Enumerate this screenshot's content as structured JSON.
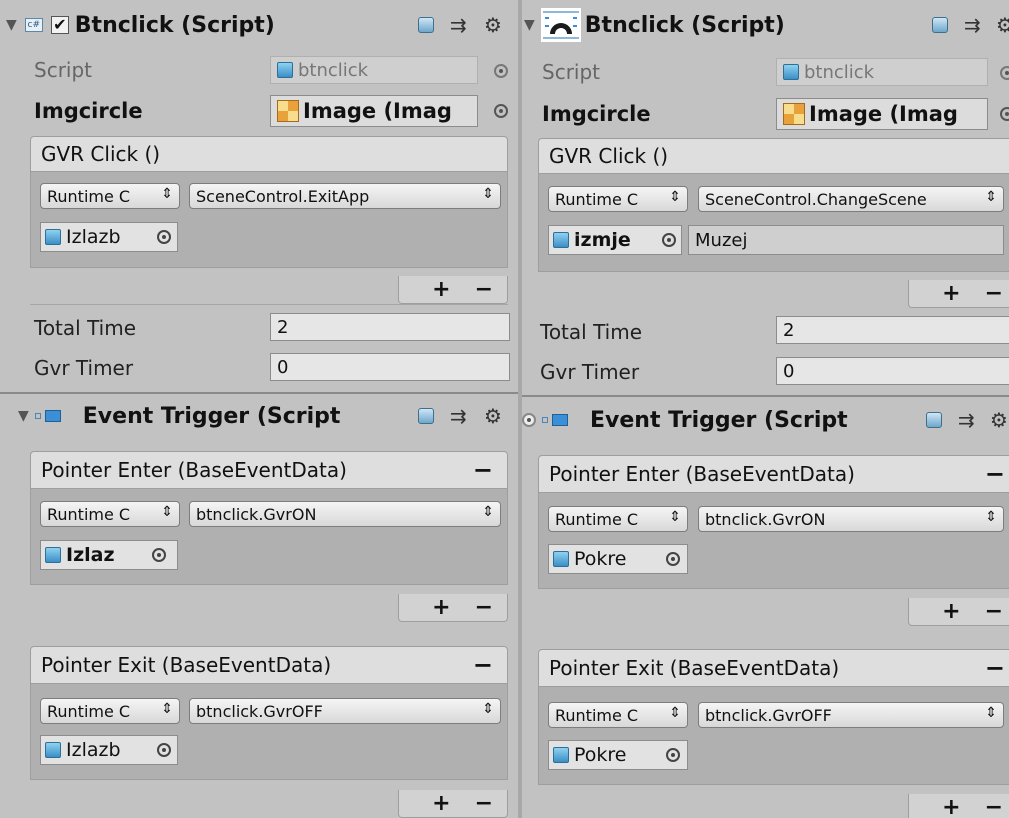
{
  "left": {
    "component_title": "Btnclick (Script)",
    "script_label": "Script",
    "script_value": "btnclick",
    "imgcircle_label": "Imgcircle",
    "imgcircle_value": "Image (Imag",
    "gvr_click": {
      "header": "GVR Click ()",
      "runtime": "Runtime C",
      "function": "SceneControl.ExitApp",
      "object": "Izlazb"
    },
    "total_time_label": "Total Time",
    "total_time_value": "2",
    "gvr_timer_label": "Gvr Timer",
    "gvr_timer_value": "0",
    "event_trigger_title": "Event Trigger (Script",
    "pointer_enter": {
      "header": "Pointer Enter (BaseEventData)",
      "runtime": "Runtime C",
      "function": "btnclick.GvrON",
      "object": "Izlaz"
    },
    "pointer_exit": {
      "header": "Pointer Exit (BaseEventData)",
      "runtime": "Runtime C",
      "function": "btnclick.GvrOFF",
      "object": "Izlazb"
    }
  },
  "right": {
    "component_title": "Btnclick (Script)",
    "script_label": "Script",
    "script_value": "btnclick",
    "imgcircle_label": "Imgcircle",
    "imgcircle_value": "Image (Imag",
    "gvr_click": {
      "header": "GVR Click ()",
      "runtime": "Runtime C",
      "function": "SceneControl.ChangeScene",
      "object": "izmje",
      "argument": "Muzej"
    },
    "total_time_label": "Total Time",
    "total_time_value": "2",
    "gvr_timer_label": "Gvr Timer",
    "gvr_timer_value": "0",
    "event_trigger_title": "Event Trigger (Script",
    "pointer_enter": {
      "header": "Pointer Enter (BaseEventData)",
      "runtime": "Runtime C",
      "function": "btnclick.GvrON",
      "object": "Pokre"
    },
    "pointer_exit": {
      "header": "Pointer Exit (BaseEventData)",
      "runtime": "Runtime C",
      "function": "btnclick.GvrOFF",
      "object": "Pokre"
    }
  },
  "symbols": {
    "add": "+",
    "remove": "−",
    "popup_arrow": "⇕",
    "checkmark": "✔",
    "foldout": "▼",
    "gear": "⚙",
    "settings_glyph": "⇉"
  },
  "icons": {
    "script_icon": "cs-script-icon",
    "image_icon": "image-icon",
    "event_trigger_icon": "event-trigger-icon",
    "help_icon": "help-book-icon",
    "preset_icon": "preset-icon",
    "gear_icon": "gear-icon"
  }
}
